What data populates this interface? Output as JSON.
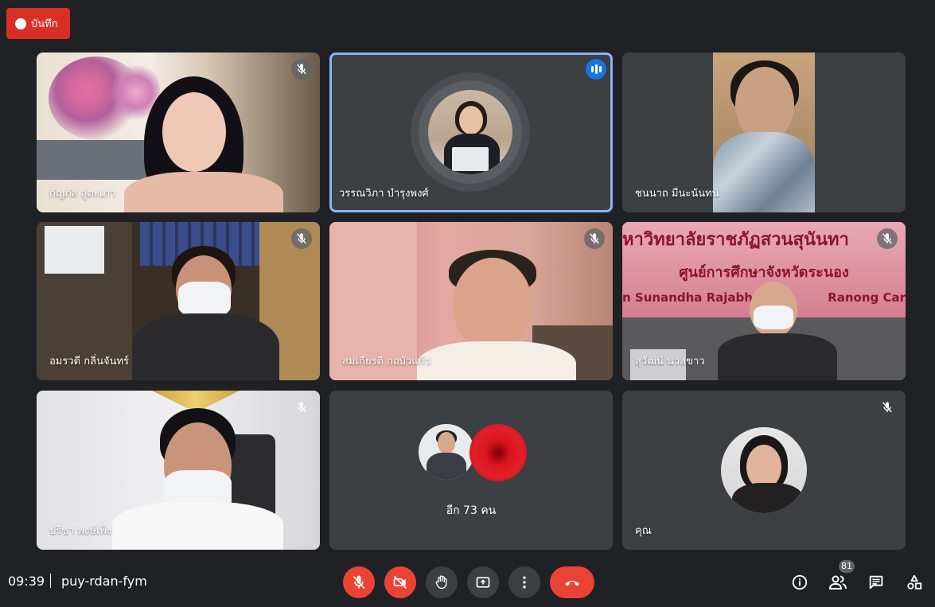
{
  "recording": {
    "label": "บันทึก",
    "color": "#d93025"
  },
  "participants": [
    {
      "name": "กัญภัส อู่ตะเภา",
      "muted": true
    },
    {
      "name": "วรรณวิภา บำรุงพงศ์",
      "muted": false,
      "speaking": true
    },
    {
      "name": "ชนนาถ มีนะนันทน์",
      "muted": false
    },
    {
      "name": "อมรวดี กลิ่นจันทร์",
      "muted": true
    },
    {
      "name": "สมเกียรติ กอบัวแก้ว",
      "muted": true
    },
    {
      "name": "สุวัฒน์ นวลขาว",
      "muted": true
    },
    {
      "name": "ปรีชา พงษ์เพ็ง",
      "muted": true
    },
    {
      "name": "คุณ",
      "muted": true
    }
  ],
  "others_tile": {
    "label": "อีก 73 คน"
  },
  "banner": {
    "line1": "หาวิทยาลัยราชภัฏสวนสุนันทา",
    "line2": "ศูนย์การศึกษาจังหวัดระนอง",
    "line3": "n Sunandha Rajabhat",
    "line4": "Ranong Car"
  },
  "meeting": {
    "time": "09:39",
    "code": "puy-rdan-fym"
  },
  "controls": {
    "mic": "mic-off-icon",
    "camera": "camera-off-icon",
    "raise_hand": "hand-icon",
    "present": "present-icon",
    "more": "more-vert-icon",
    "end_call": "call-end-icon"
  },
  "side_panel": {
    "people_count": "81"
  },
  "colors": {
    "accent": "#8ab4f8",
    "danger": "#ea4335",
    "background": "#202124",
    "tile": "#3c4043"
  }
}
